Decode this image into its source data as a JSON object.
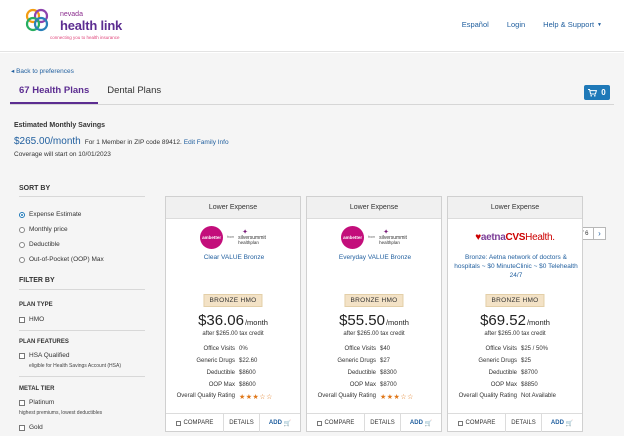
{
  "header": {
    "logo_top": "nevada",
    "logo_main": "health link",
    "tagline": "connecting you to health insurance",
    "nav": [
      "Español",
      "Login",
      "Help & Support"
    ]
  },
  "page": {
    "back_link": "Back to preferences",
    "tabs": [
      {
        "label": "67 Health Plans",
        "active": true
      },
      {
        "label": "Dental Plans",
        "active": false
      }
    ],
    "cart_count": "0",
    "savings": {
      "title": "Estimated Monthly Savings",
      "amount": "$265.00/month",
      "detail": "For 1 Member in ZIP code 89412.",
      "edit_link": "Edit Family Info",
      "coverage": "Coverage will start on 10/01/2023"
    },
    "pager": "1 of 6"
  },
  "sidebar": {
    "sort_heading": "SORT BY",
    "sort_options": [
      {
        "label": "Expense Estimate",
        "selected": true
      },
      {
        "label": "Monthly price",
        "selected": false
      },
      {
        "label": "Deductible",
        "selected": false
      },
      {
        "label": "Out-of-Pocket (OOP) Max",
        "selected": false
      }
    ],
    "filter_heading": "FILTER BY",
    "plan_type_heading": "PLAN TYPE",
    "plan_type_option": "HMO",
    "plan_features_heading": "PLAN FEATURES",
    "hsa_label": "HSA Qualified",
    "hsa_note": "eligible for Health Savings Account (HSA)",
    "metal_tier_heading": "METAL TIER",
    "platinum_label": "Platinum",
    "platinum_note": "highest premiums, lowest deductibles",
    "gold_label": "Gold"
  },
  "labels": {
    "office_visits": "Office Visits",
    "generic_drugs": "Generic Drugs",
    "deductible": "Deductible",
    "oop_max": "OOP Max",
    "quality": "Overall Quality Rating",
    "compare": "COMPARE",
    "details": "DETAILS",
    "add": "ADD",
    "per_month": "/month",
    "from": "from",
    "ss_line1": "silversummit",
    "ss_line2": "healthplan",
    "ambetter": "ambetter"
  },
  "plans": [
    {
      "header": "Lower Expense",
      "carrier": "ambetter",
      "name": "Clear VALUE Bronze",
      "badge": "BRONZE  HMO",
      "price": "$36.06",
      "credit": "after $265.00 tax credit",
      "office_visits": "0%",
      "generic_drugs": "$22.60",
      "deductible": "$8600",
      "oop_max": "$8600",
      "quality_stars": 3,
      "quality_text": ""
    },
    {
      "header": "Lower Expense",
      "carrier": "ambetter",
      "name": "Everyday VALUE Bronze",
      "badge": "BRONZE  HMO",
      "price": "$55.50",
      "credit": "after $265.00 tax credit",
      "office_visits": "$40",
      "generic_drugs": "$27",
      "deductible": "$8300",
      "oop_max": "$8700",
      "quality_stars": 3,
      "quality_text": ""
    },
    {
      "header": "Lower Expense",
      "carrier": "aetna",
      "name": "Bronze: Aetna network of doctors & hospitals ~ $0 MinuteClinic ~ $0 Telehealth 24/7",
      "badge": "BRONZE  HMO",
      "price": "$69.52",
      "credit": "after $265.00 tax credit",
      "office_visits": "$25 / 50%",
      "generic_drugs": "$25",
      "deductible": "$8700",
      "oop_max": "$8850",
      "quality_stars": 0,
      "quality_text": "Not Available"
    }
  ],
  "aetna_logo": {
    "a": "aetna",
    "b": "CVS",
    "c": "Health."
  },
  "colors": {
    "brand_purple": "#5c2d91",
    "link_blue": "#1f5e9e",
    "cart_blue": "#1f79b8",
    "badge_bg": "#f3e2c6",
    "star_orange": "#e0781a"
  }
}
